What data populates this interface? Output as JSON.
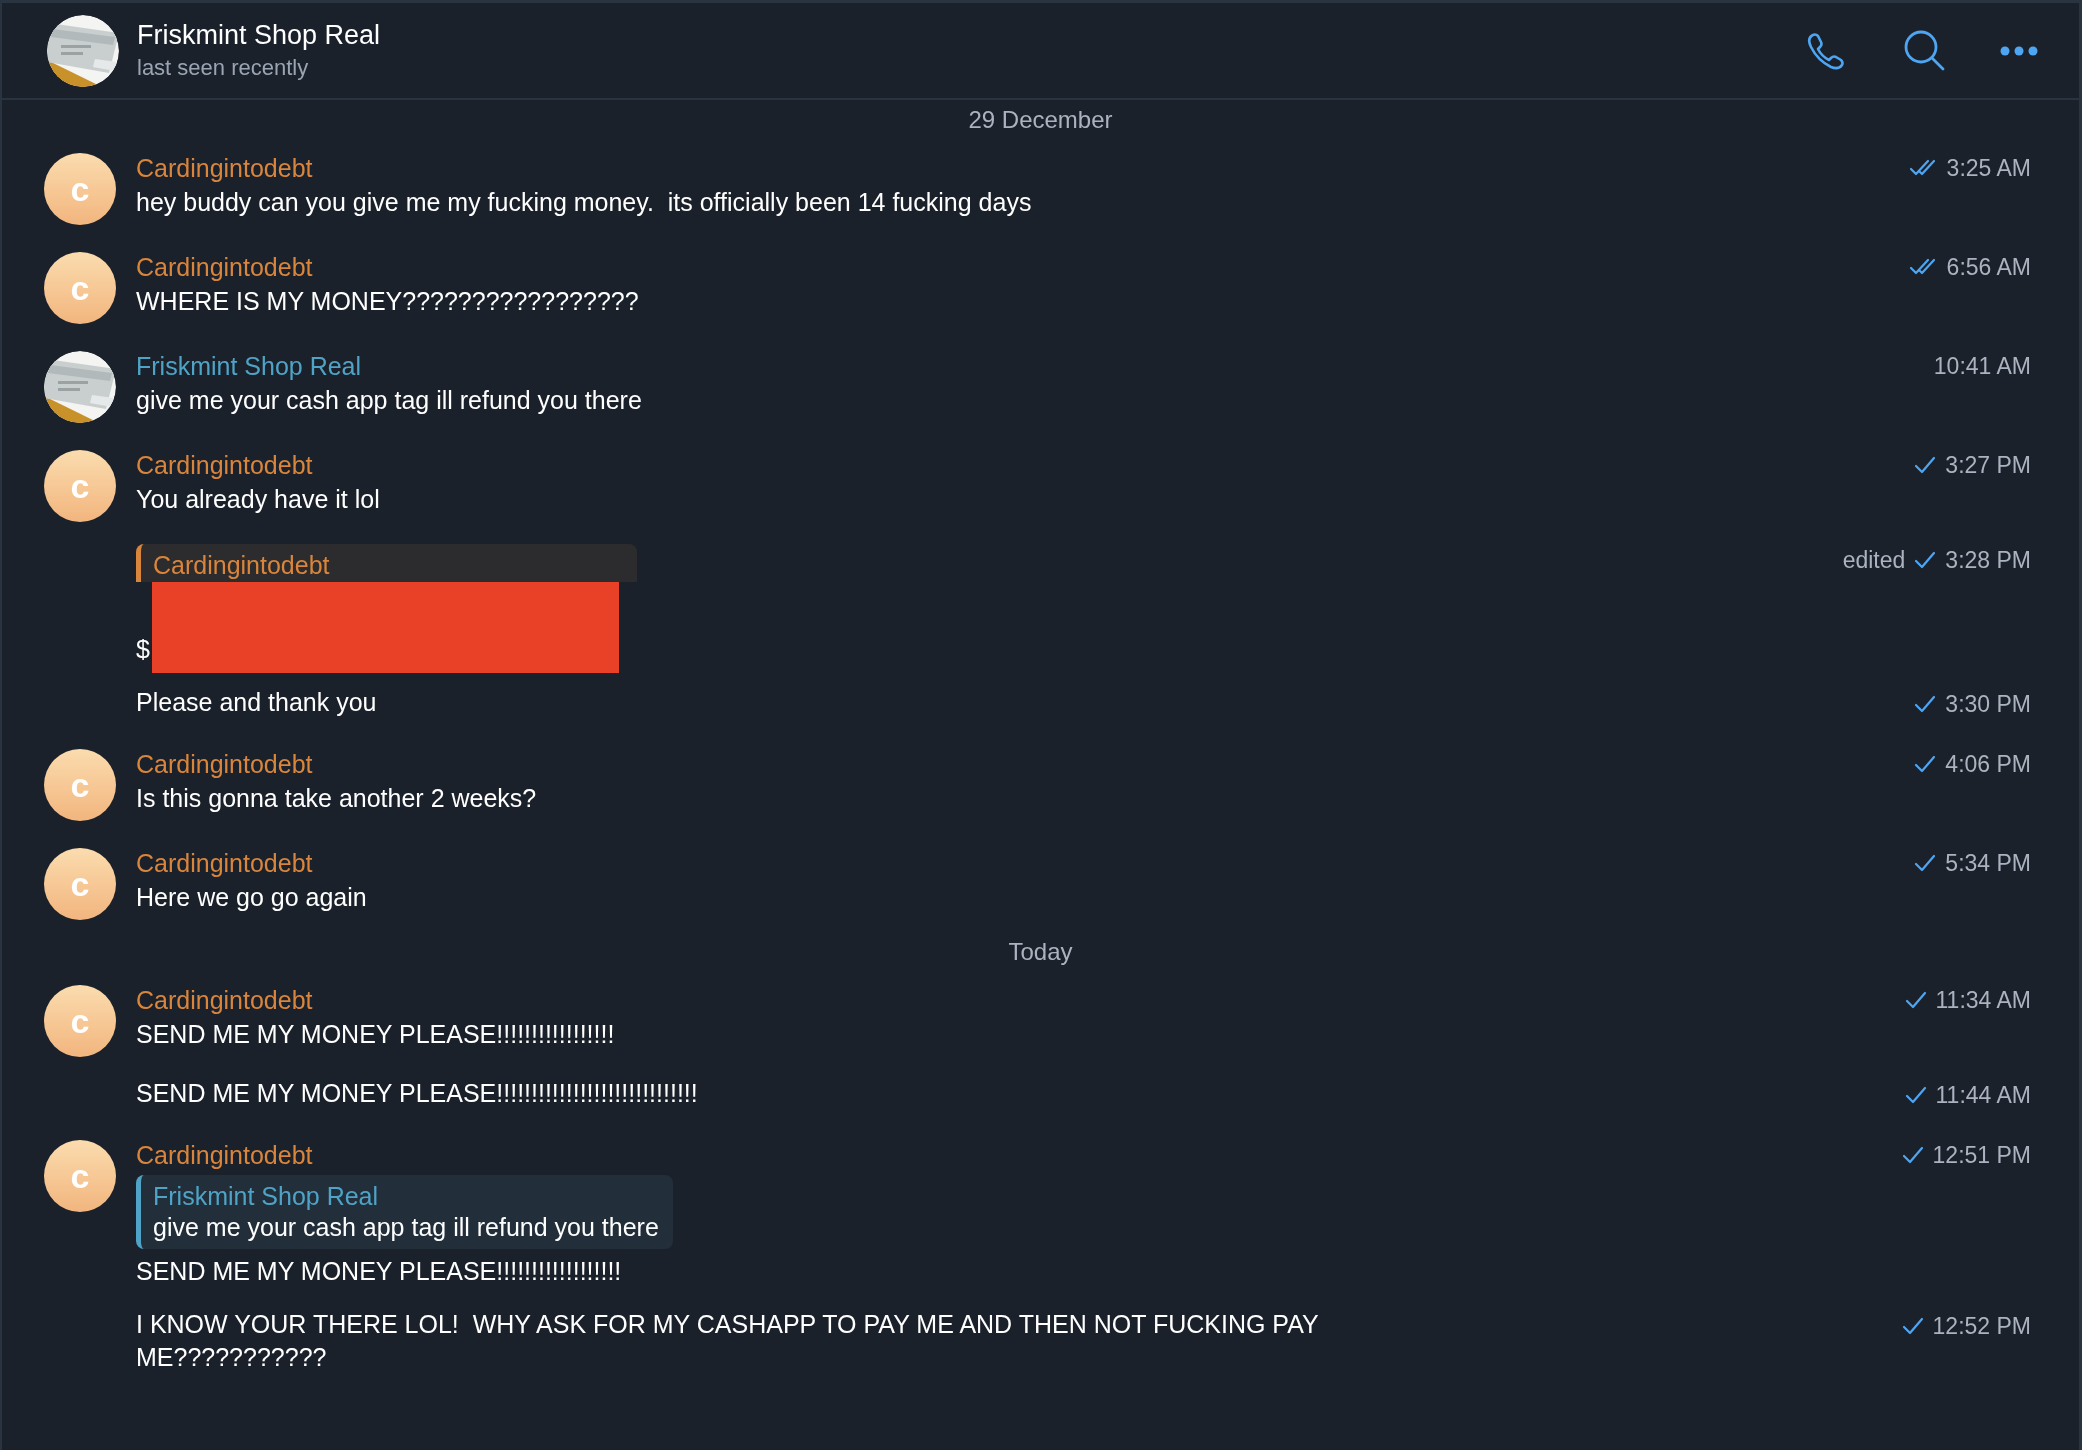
{
  "header": {
    "title": "Friskmint Shop Real",
    "status": "last seen recently"
  },
  "items": [
    {
      "kind": "date",
      "text": "29 December"
    },
    {
      "kind": "message",
      "sender": {
        "name": "Cardingintodebt",
        "color": "#d9853b",
        "avatar": {
          "kind": "letter",
          "letter": "c"
        }
      },
      "text": "hey buddy can you give me my fucking money.  its officially been 14 fucking days",
      "time": "3:25 AM",
      "read": true
    },
    {
      "kind": "message",
      "sender": {
        "name": "Cardingintodebt",
        "color": "#d9853b",
        "avatar": {
          "kind": "letter",
          "letter": "c"
        }
      },
      "text": "WHERE IS MY MONEY?????????????????",
      "time": "6:56 AM",
      "read": true
    },
    {
      "kind": "message",
      "sender": {
        "name": "Friskmint Shop Real",
        "color": "#4fa3c6"
      },
      "text": "give me your cash app tag ill refund you there",
      "time": "10:41 AM"
    },
    {
      "kind": "message",
      "sender": {
        "name": "Cardingintodebt",
        "color": "#d9853b",
        "avatar": {
          "kind": "letter",
          "letter": "c"
        }
      },
      "text": "You already have it lol",
      "time": "3:27 PM",
      "read": false
    },
    {
      "kind": "message",
      "quote": {
        "name": "Cardingintodebt",
        "color": "#d9853b"
      },
      "redacted": true,
      "text": "$",
      "edited": "edited",
      "time": "3:28 PM",
      "read": false
    },
    {
      "kind": "message",
      "text": "Please and thank you",
      "time": "3:30 PM",
      "read": false
    },
    {
      "kind": "message",
      "sender": {
        "name": "Cardingintodebt",
        "color": "#d9853b",
        "avatar": {
          "kind": "letter",
          "letter": "c"
        }
      },
      "text": "Is this gonna take another 2 weeks?",
      "time": "4:06 PM",
      "read": false
    },
    {
      "kind": "message",
      "sender": {
        "name": "Cardingintodebt",
        "color": "#d9853b",
        "avatar": {
          "kind": "letter",
          "letter": "c"
        }
      },
      "text": "Here we go go again",
      "time": "5:34 PM",
      "read": false
    },
    {
      "kind": "date",
      "text": "Today"
    },
    {
      "kind": "message",
      "sender": {
        "name": "Cardingintodebt",
        "color": "#d9853b",
        "avatar": {
          "kind": "letter",
          "letter": "c"
        }
      },
      "text": "SEND ME MY MONEY PLEASE!!!!!!!!!!!!!!!!!",
      "time": "11:34 AM",
      "read": false
    },
    {
      "kind": "message",
      "text": "SEND ME MY MONEY PLEASE!!!!!!!!!!!!!!!!!!!!!!!!!!!!!",
      "time": "11:44 AM",
      "read": false
    },
    {
      "kind": "message",
      "sender": {
        "name": "Cardingintodebt",
        "color": "#d9853b",
        "avatar": {
          "kind": "letter",
          "letter": "c"
        }
      },
      "quote": {
        "name": "Friskmint Shop Real",
        "color": "#4fa3c6",
        "text": "give me your cash app tag ill refund you there"
      },
      "text": "SEND ME MY MONEY PLEASE!!!!!!!!!!!!!!!!!!",
      "time": "12:51 PM",
      "read": false
    },
    {
      "kind": "message",
      "text": "I KNOW YOUR THERE LOL!  WHY ASK FOR MY CASHAPP TO PAY ME AND THEN NOT FUCKING PAY ME???????????",
      "time": "12:52 PM",
      "read": false
    }
  ]
}
